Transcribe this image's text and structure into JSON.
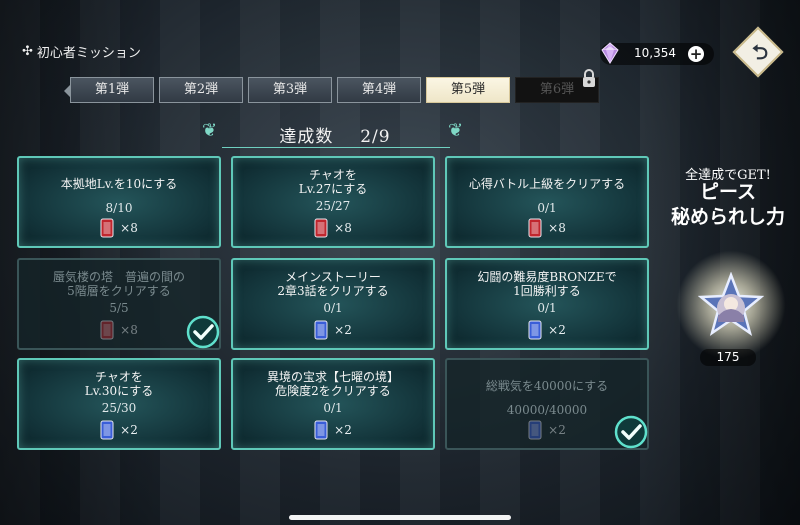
{
  "header": {
    "title": "初心者ミッション",
    "gem_count": "10,354",
    "plus_label": "+"
  },
  "tabs": [
    {
      "label": "第1弾",
      "state": "normal"
    },
    {
      "label": "第2弾",
      "state": "normal"
    },
    {
      "label": "第3弾",
      "state": "normal"
    },
    {
      "label": "第4弾",
      "state": "normal"
    },
    {
      "label": "第5弾",
      "state": "active"
    },
    {
      "label": "第6弾",
      "state": "locked"
    }
  ],
  "progress_header": {
    "label": "達成数",
    "value": "2/9"
  },
  "missions": [
    {
      "line1": "本拠地Lv.を10にする",
      "line2": "",
      "progress": "8/10",
      "reward_qty": "×8",
      "reward_type": "red-ticket-icon",
      "completed": false
    },
    {
      "line1": "チャオを",
      "line2": "Lv.27にする",
      "progress": "25/27",
      "reward_qty": "×8",
      "reward_type": "red-ticket-icon",
      "completed": false
    },
    {
      "line1": "心得バトル上級をクリアする",
      "line2": "",
      "progress": "0/1",
      "reward_qty": "×8",
      "reward_type": "red-ticket-icon",
      "completed": false
    },
    {
      "line1": "蜃気楼の塔　普遍の間の",
      "line2": "5階層をクリアする",
      "progress": "5/5",
      "reward_qty": "×8",
      "reward_type": "red-ticket-icon",
      "completed": true
    },
    {
      "line1": "メインストーリー",
      "line2": "2章3話をクリアする",
      "progress": "0/1",
      "reward_qty": "×2",
      "reward_type": "blue-ticket-icon",
      "completed": false
    },
    {
      "line1": "幻闘の難易度BRONZEで",
      "line2": "1回勝利する",
      "progress": "0/1",
      "reward_qty": "×2",
      "reward_type": "blue-ticket-icon",
      "completed": false
    },
    {
      "line1": "チャオを",
      "line2": "Lv.30にする",
      "progress": "25/30",
      "reward_qty": "×2",
      "reward_type": "blue-ticket-icon",
      "completed": false
    },
    {
      "line1": "異境の宝求【七曜の境】",
      "line2": "危険度2をクリアする",
      "progress": "0/1",
      "reward_qty": "×2",
      "reward_type": "blue-ticket-icon",
      "completed": false
    },
    {
      "line1": "総戦気を40000にする",
      "line2": "",
      "progress": "40000/40000",
      "reward_qty": "×2",
      "reward_type": "blue-ticket-icon",
      "completed": true
    }
  ],
  "reward_panel": {
    "line1": "全達成でGET!",
    "line2": "ピース",
    "line3": "秘められし力",
    "count": "175"
  },
  "colors": {
    "accent": "#5fc8b8",
    "red_ticket": "#c0262e",
    "blue_ticket": "#3a5ed8"
  }
}
